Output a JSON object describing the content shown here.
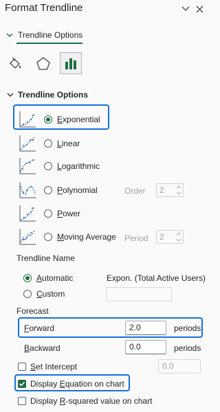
{
  "pane": {
    "title": "Format Trendline",
    "tab_label": "Trendline Options"
  },
  "section": {
    "title": "Trendline Options"
  },
  "types": [
    {
      "label_u": "E",
      "label_rest": "xponential",
      "selected": true
    },
    {
      "label_u": "L",
      "label_rest": "inear",
      "selected": false
    },
    {
      "label_u": "L",
      "label_rest": "ogarithmic",
      "selected": false
    },
    {
      "label_u": "P",
      "label_rest": "olynomial",
      "selected": false
    },
    {
      "label_u": "P",
      "label_rest": "ower",
      "selected": false
    },
    {
      "label_u": "M",
      "label_rest": "oving Average",
      "selected": false
    }
  ],
  "order": {
    "label": "Order",
    "value": "2"
  },
  "period": {
    "label": "Period",
    "value": "2"
  },
  "name": {
    "heading": "Trendline Name",
    "automatic_u": "A",
    "automatic_rest": "utomatic",
    "automatic_value": "Expon. (Total Active Users)",
    "custom_u": "C",
    "custom_rest": "ustom",
    "custom_value": ""
  },
  "forecast": {
    "heading": "Forecast",
    "forward_u": "F",
    "forward_rest": "orward",
    "forward_value": "2.0",
    "backward_u": "B",
    "backward_rest": "ackward",
    "backward_value": "0.0",
    "unit": "periods"
  },
  "intercept": {
    "label_u": "S",
    "label_rest": "et Intercept",
    "value": "0.0",
    "checked": false
  },
  "display_equation": {
    "pre": "Display ",
    "u": "E",
    "rest": "quation on chart",
    "checked": true
  },
  "display_r2": {
    "pre": "Display ",
    "u": "R",
    "rest": "-squared value on chart",
    "checked": false
  },
  "colors": {
    "accent": "#1d6f42",
    "highlight": "#1570d8"
  }
}
